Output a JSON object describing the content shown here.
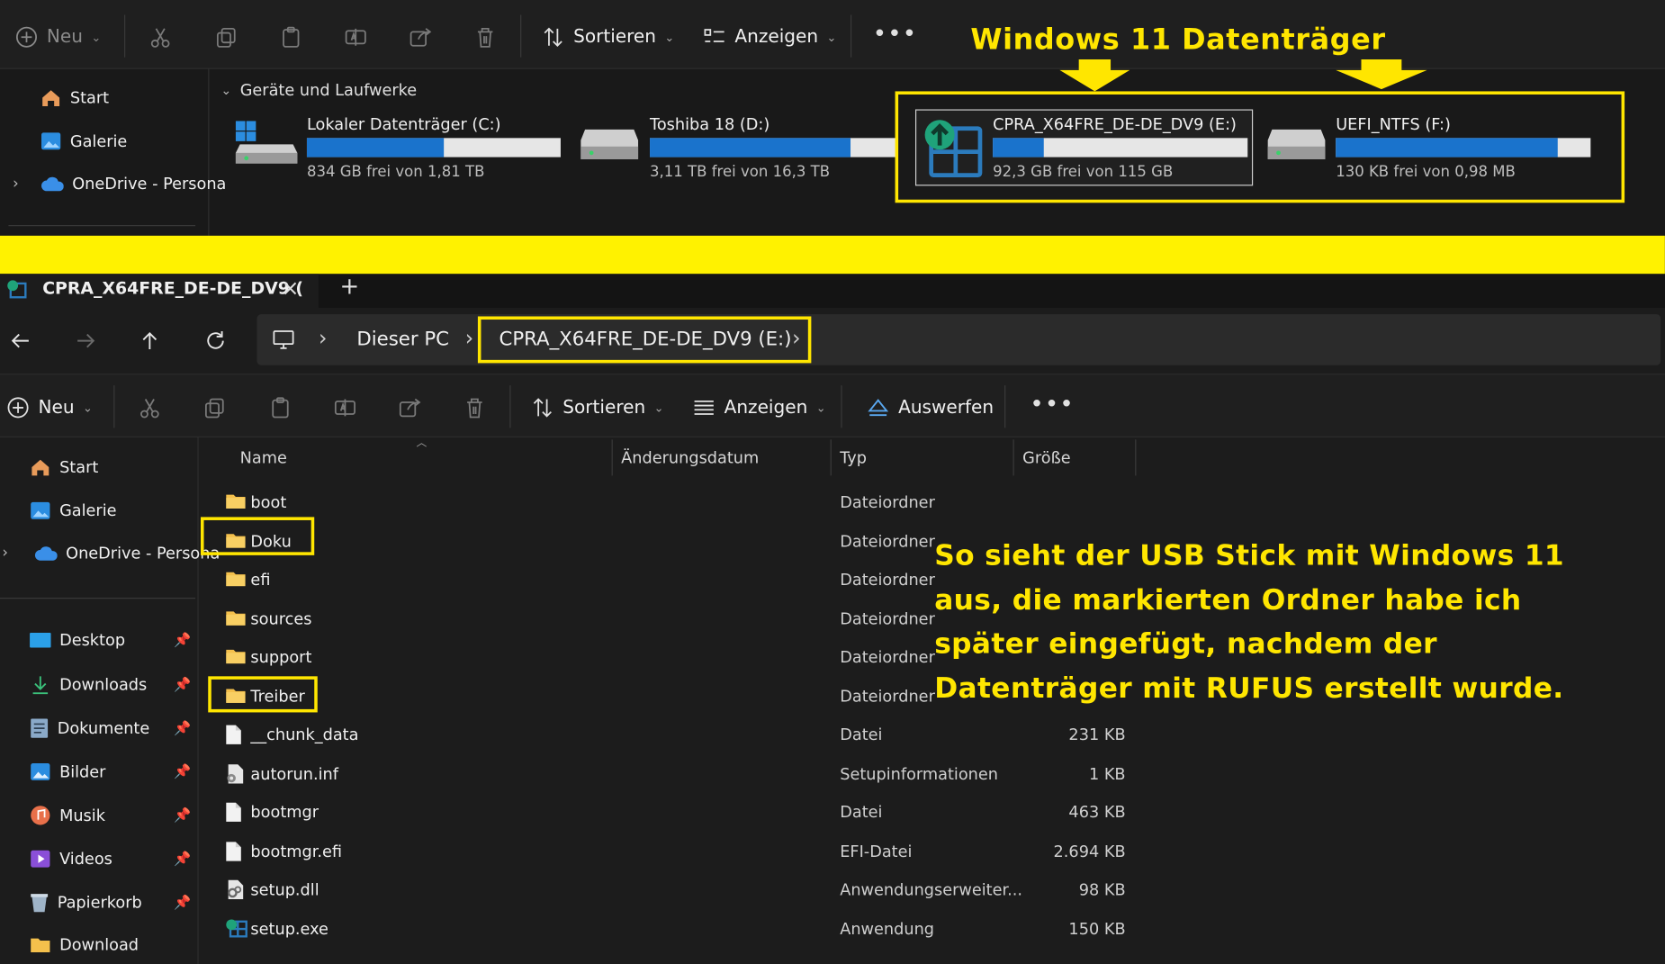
{
  "top_window": {
    "toolbar": {
      "new_label": "Neu",
      "sort_label": "Sortieren",
      "view_label": "Anzeigen"
    },
    "heading_annotation": "Windows 11 Datenträger",
    "sidebar": [
      {
        "label": "Start",
        "icon": "home-icon"
      },
      {
        "label": "Galerie",
        "icon": "gallery-icon"
      },
      {
        "label": "OneDrive - Persona",
        "icon": "cloud-icon"
      }
    ],
    "section_label": "Geräte und Laufwerke",
    "drives": [
      {
        "name": "Lokaler Datenträger (C:)",
        "free": "834 GB frei von 1,81 TB",
        "used_fraction": 0.54
      },
      {
        "name": "Toshiba 18 (D:)",
        "free": "3,11 TB frei von 16,3 TB",
        "used_fraction": 0.81
      },
      {
        "name": "CPRA_X64FRE_DE-DE_DV9 (E:)",
        "free": "92,3 GB frei von 115 GB",
        "used_fraction": 0.2
      },
      {
        "name": "UEFI_NTFS (F:)",
        "free": "130 KB frei von 0,98 MB",
        "used_fraction": 0.87
      }
    ]
  },
  "tab": {
    "title": "CPRA_X64FRE_DE-DE_DV9 (",
    "close": "×",
    "new_tab": "+"
  },
  "address": {
    "crumb_pc": "Dieser PC",
    "crumb_drive": "CPRA_X64FRE_DE-DE_DV9 (E:)",
    "sep": "›"
  },
  "toolbar": {
    "new_label": "Neu",
    "sort_label": "Sortieren",
    "view_label": "Anzeigen",
    "eject_label": "Auswerfen"
  },
  "sidebar": {
    "top": [
      {
        "label": "Start"
      },
      {
        "label": "Galerie"
      },
      {
        "label": "OneDrive - Persona"
      }
    ],
    "quick": [
      {
        "label": "Desktop"
      },
      {
        "label": "Downloads"
      },
      {
        "label": "Dokumente"
      },
      {
        "label": "Bilder"
      },
      {
        "label": "Musik"
      },
      {
        "label": "Videos"
      },
      {
        "label": "Papierkorb"
      },
      {
        "label": "Download"
      }
    ]
  },
  "columns": {
    "name": "Name",
    "date": "Änderungsdatum",
    "type": "Typ",
    "size": "Größe"
  },
  "files": [
    {
      "name": "boot",
      "type": "Dateiordner",
      "size": "",
      "kind": "folder"
    },
    {
      "name": "Doku",
      "type": "Dateiordner",
      "size": "",
      "kind": "folder"
    },
    {
      "name": "efi",
      "type": "Dateiordner",
      "size": "",
      "kind": "folder"
    },
    {
      "name": "sources",
      "type": "Dateiordner",
      "size": "",
      "kind": "folder"
    },
    {
      "name": "support",
      "type": "Dateiordner",
      "size": "",
      "kind": "folder"
    },
    {
      "name": "Treiber",
      "type": "Dateiordner",
      "size": "",
      "kind": "folder"
    },
    {
      "name": "__chunk_data",
      "type": "Datei",
      "size": "231 KB",
      "kind": "file"
    },
    {
      "name": "autorun.inf",
      "type": "Setupinformationen",
      "size": "1 KB",
      "kind": "setup"
    },
    {
      "name": "bootmgr",
      "type": "Datei",
      "size": "463 KB",
      "kind": "file"
    },
    {
      "name": "bootmgr.efi",
      "type": "EFI-Datei",
      "size": "2.694 KB",
      "kind": "file"
    },
    {
      "name": "setup.dll",
      "type": "Anwendungserweiter...",
      "size": "98 KB",
      "kind": "dll"
    },
    {
      "name": "setup.exe",
      "type": "Anwendung",
      "size": "150 KB",
      "kind": "exe"
    }
  ],
  "annotation": {
    "lines": [
      "So sieht der USB Stick mit Windows 11",
      "aus, die markierten Ordner habe ich",
      "später eingefügt, nachdem der",
      "Datenträger mit RUFUS erstellt wurde."
    ]
  },
  "colors": {
    "highlight": "#ffe600",
    "accent": "#1a73cc",
    "folder": "#f4c04c",
    "background": "#1c1c1c"
  }
}
